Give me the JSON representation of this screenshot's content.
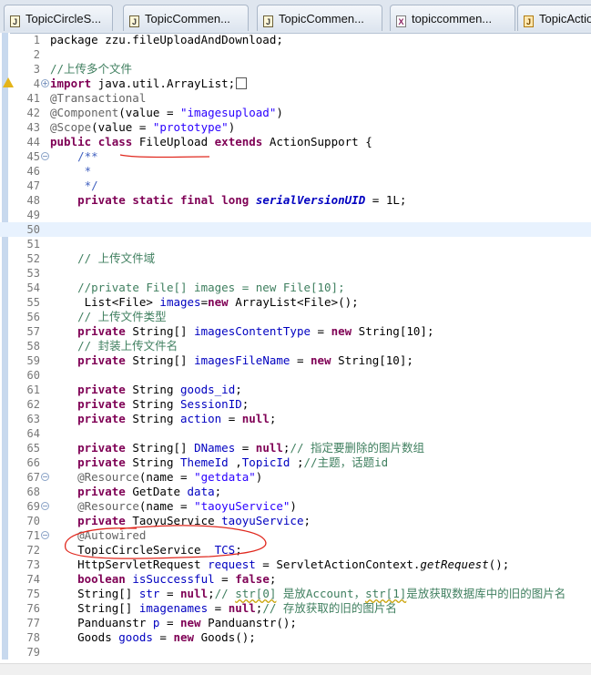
{
  "tabs": [
    {
      "label": "TopicCircleS...",
      "icon": "java-file-icon",
      "icon_glyph": "J"
    },
    {
      "label": "TopicCommen...",
      "icon": "java-file-icon",
      "icon_glyph": "J"
    },
    {
      "label": "TopicCommen...",
      "icon": "java-file-icon",
      "icon_glyph": "J"
    },
    {
      "label": "topiccommen...",
      "icon": "xml-file-icon",
      "icon_glyph": "X"
    },
    {
      "label": "TopicActio",
      "icon": "java-class-icon",
      "icon_glyph": "J"
    }
  ],
  "annotation_color": "#e0281e",
  "lines": [
    {
      "n": "1",
      "tokens": [
        {
          "t": "package zzu.fileUploadAndDownload;"
        }
      ]
    },
    {
      "n": "2",
      "tokens": []
    },
    {
      "n": "3",
      "tokens": [
        {
          "t": "//上传多个文件",
          "c": "cm"
        }
      ]
    },
    {
      "n": "4",
      "fold": "+",
      "warn": true,
      "tokens": [
        {
          "t": "import",
          "c": "kw"
        },
        {
          "t": " java.util.ArrayList;"
        }
      ],
      "box": true
    },
    {
      "n": "41",
      "tokens": [
        {
          "t": "@Transactional",
          "c": "ann"
        }
      ]
    },
    {
      "n": "42",
      "tokens": [
        {
          "t": "@Component",
          "c": "ann"
        },
        {
          "t": "(value = "
        },
        {
          "t": "\"imagesupload\"",
          "c": "str"
        },
        {
          "t": ")"
        }
      ]
    },
    {
      "n": "43",
      "tokens": [
        {
          "t": "@Scope",
          "c": "ann"
        },
        {
          "t": "(value = "
        },
        {
          "t": "\"prototype\"",
          "c": "str"
        },
        {
          "t": ")"
        }
      ]
    },
    {
      "n": "44",
      "tokens": [
        {
          "t": "public",
          "c": "kw"
        },
        {
          "t": " "
        },
        {
          "t": "class",
          "c": "kw"
        },
        {
          "t": " FileUpload "
        },
        {
          "t": "extends",
          "c": "kw"
        },
        {
          "t": " ActionSupport {"
        }
      ]
    },
    {
      "n": "45",
      "fold": "-",
      "tokens": [
        {
          "t": "    /**",
          "c": "jd"
        }
      ]
    },
    {
      "n": "46",
      "tokens": [
        {
          "t": "     *",
          "c": "jd"
        }
      ]
    },
    {
      "n": "47",
      "tokens": [
        {
          "t": "     */",
          "c": "jd"
        }
      ]
    },
    {
      "n": "48",
      "tokens": [
        {
          "t": "    "
        },
        {
          "t": "private",
          "c": "kw"
        },
        {
          "t": " "
        },
        {
          "t": "static",
          "c": "kw"
        },
        {
          "t": " "
        },
        {
          "t": "final",
          "c": "kw"
        },
        {
          "t": " "
        },
        {
          "t": "long",
          "c": "kw"
        },
        {
          "t": " "
        },
        {
          "t": "serialVersionUID",
          "c": "sf"
        },
        {
          "t": " = 1L;"
        }
      ]
    },
    {
      "n": "49",
      "tokens": []
    },
    {
      "n": "50",
      "current": true,
      "tokens": []
    },
    {
      "n": "51",
      "tokens": []
    },
    {
      "n": "52",
      "tokens": [
        {
          "t": "    "
        },
        {
          "t": "// 上传文件域",
          "c": "cm"
        }
      ]
    },
    {
      "n": "53",
      "tokens": []
    },
    {
      "n": "54",
      "tokens": [
        {
          "t": "    "
        },
        {
          "t": "//private File[] images = new File[10];",
          "c": "cm"
        }
      ]
    },
    {
      "n": "55",
      "tokens": [
        {
          "t": "     List<File> "
        },
        {
          "t": "images",
          "c": "fld"
        },
        {
          "t": "="
        },
        {
          "t": "new",
          "c": "kw"
        },
        {
          "t": " ArrayList<File>();"
        }
      ]
    },
    {
      "n": "56",
      "tokens": [
        {
          "t": "    "
        },
        {
          "t": "// 上传文件类型",
          "c": "cm"
        }
      ]
    },
    {
      "n": "57",
      "tokens": [
        {
          "t": "    "
        },
        {
          "t": "private",
          "c": "kw"
        },
        {
          "t": " String[] "
        },
        {
          "t": "imagesContentType",
          "c": "fld"
        },
        {
          "t": " = "
        },
        {
          "t": "new",
          "c": "kw"
        },
        {
          "t": " String[10];"
        }
      ]
    },
    {
      "n": "58",
      "tokens": [
        {
          "t": "    "
        },
        {
          "t": "// 封装上传文件名",
          "c": "cm"
        }
      ]
    },
    {
      "n": "59",
      "tokens": [
        {
          "t": "    "
        },
        {
          "t": "private",
          "c": "kw"
        },
        {
          "t": " String[] "
        },
        {
          "t": "imagesFileName",
          "c": "fld"
        },
        {
          "t": " = "
        },
        {
          "t": "new",
          "c": "kw"
        },
        {
          "t": " String[10];"
        }
      ]
    },
    {
      "n": "60",
      "tokens": []
    },
    {
      "n": "61",
      "tokens": [
        {
          "t": "    "
        },
        {
          "t": "private",
          "c": "kw"
        },
        {
          "t": " String "
        },
        {
          "t": "goods_id",
          "c": "fld"
        },
        {
          "t": ";"
        }
      ]
    },
    {
      "n": "62",
      "tokens": [
        {
          "t": "    "
        },
        {
          "t": "private",
          "c": "kw"
        },
        {
          "t": " String "
        },
        {
          "t": "SessionID",
          "c": "fld"
        },
        {
          "t": ";"
        }
      ]
    },
    {
      "n": "63",
      "tokens": [
        {
          "t": "    "
        },
        {
          "t": "private",
          "c": "kw"
        },
        {
          "t": " String "
        },
        {
          "t": "action",
          "c": "fld"
        },
        {
          "t": " = "
        },
        {
          "t": "null",
          "c": "kw"
        },
        {
          "t": ";"
        }
      ]
    },
    {
      "n": "64",
      "tokens": []
    },
    {
      "n": "65",
      "tokens": [
        {
          "t": "    "
        },
        {
          "t": "private",
          "c": "kw"
        },
        {
          "t": " String[] "
        },
        {
          "t": "DNames",
          "c": "fld"
        },
        {
          "t": " = "
        },
        {
          "t": "null",
          "c": "kw"
        },
        {
          "t": ";"
        },
        {
          "t": "// 指定要删除的图片数组",
          "c": "cm"
        }
      ]
    },
    {
      "n": "66",
      "tokens": [
        {
          "t": "    "
        },
        {
          "t": "private",
          "c": "kw"
        },
        {
          "t": " String "
        },
        {
          "t": "ThemeId",
          "c": "fld"
        },
        {
          "t": " ,"
        },
        {
          "t": "TopicId",
          "c": "fld"
        },
        {
          "t": " ;"
        },
        {
          "t": "//主题，话题id",
          "c": "cm"
        }
      ]
    },
    {
      "n": "67",
      "fold": "-",
      "tokens": [
        {
          "t": "    "
        },
        {
          "t": "@Resource",
          "c": "ann"
        },
        {
          "t": "(name = "
        },
        {
          "t": "\"getdata\"",
          "c": "str"
        },
        {
          "t": ")"
        }
      ]
    },
    {
      "n": "68",
      "tokens": [
        {
          "t": "    "
        },
        {
          "t": "private",
          "c": "kw"
        },
        {
          "t": " GetDate "
        },
        {
          "t": "data",
          "c": "fld"
        },
        {
          "t": ";"
        }
      ]
    },
    {
      "n": "69",
      "fold": "-",
      "tokens": [
        {
          "t": "    "
        },
        {
          "t": "@Resource",
          "c": "ann"
        },
        {
          "t": "(name = "
        },
        {
          "t": "\"taoyuService\"",
          "c": "str"
        },
        {
          "t": ")"
        }
      ]
    },
    {
      "n": "70",
      "tokens": [
        {
          "t": "    "
        },
        {
          "t": "private",
          "c": "kw"
        },
        {
          "t": " TaoyuService "
        },
        {
          "t": "taoyuService",
          "c": "fld"
        },
        {
          "t": ";"
        }
      ]
    },
    {
      "n": "71",
      "fold": "-",
      "tokens": [
        {
          "t": "    "
        },
        {
          "t": "@Autowired",
          "c": "ann"
        }
      ]
    },
    {
      "n": "72",
      "tokens": [
        {
          "t": "    TopicCircleService  "
        },
        {
          "t": "TCS",
          "c": "fld"
        },
        {
          "t": ";"
        }
      ]
    },
    {
      "n": "73",
      "tokens": [
        {
          "t": "    HttpServletRequest "
        },
        {
          "t": "request",
          "c": "fld"
        },
        {
          "t": " = ServletActionContext."
        },
        {
          "t": "getRequest",
          "c": "mi"
        },
        {
          "t": "();"
        }
      ]
    },
    {
      "n": "74",
      "tokens": [
        {
          "t": "    "
        },
        {
          "t": "boolean",
          "c": "kw"
        },
        {
          "t": " "
        },
        {
          "t": "isSuccessful",
          "c": "fld"
        },
        {
          "t": " = "
        },
        {
          "t": "false",
          "c": "kw"
        },
        {
          "t": ";"
        }
      ]
    },
    {
      "n": "75",
      "tokens": [
        {
          "t": "    String[] "
        },
        {
          "t": "str",
          "c": "fld"
        },
        {
          "t": " = "
        },
        {
          "t": "null",
          "c": "kw"
        },
        {
          "t": ";"
        },
        {
          "t": "// ",
          "c": "cm"
        },
        {
          "t": "str[0]",
          "c": "cm ul"
        },
        {
          "t": " 是放Account，",
          "c": "cm"
        },
        {
          "t": "str[1]",
          "c": "cm ul"
        },
        {
          "t": "是放获取数据库中的旧的图片名",
          "c": "cm"
        }
      ]
    },
    {
      "n": "76",
      "tokens": [
        {
          "t": "    String[] "
        },
        {
          "t": "imagenames",
          "c": "fld"
        },
        {
          "t": " = "
        },
        {
          "t": "null",
          "c": "kw"
        },
        {
          "t": ";"
        },
        {
          "t": "// 存放获取的旧的图片名",
          "c": "cm"
        }
      ]
    },
    {
      "n": "77",
      "tokens": [
        {
          "t": "    Panduanstr "
        },
        {
          "t": "p",
          "c": "fld"
        },
        {
          "t": " = "
        },
        {
          "t": "new",
          "c": "kw"
        },
        {
          "t": " Panduanstr();"
        }
      ]
    },
    {
      "n": "78",
      "tokens": [
        {
          "t": "    Goods "
        },
        {
          "t": "goods",
          "c": "fld"
        },
        {
          "t": " = "
        },
        {
          "t": "new",
          "c": "kw"
        },
        {
          "t": " Goods();"
        }
      ]
    },
    {
      "n": "79",
      "tokens": []
    }
  ]
}
